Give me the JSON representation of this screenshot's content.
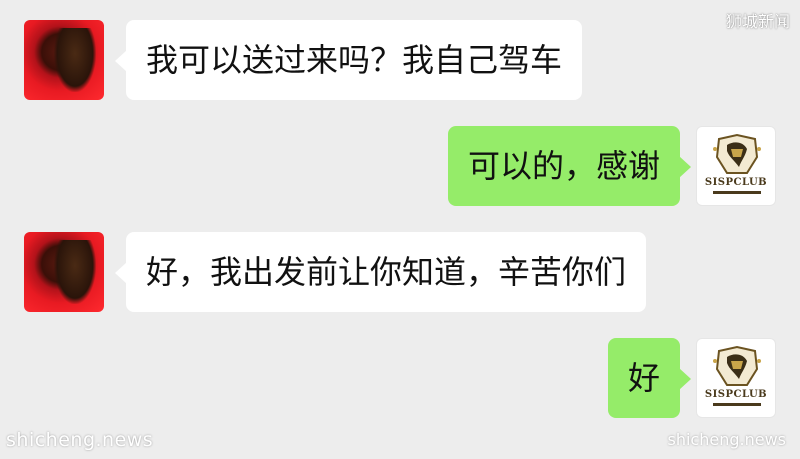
{
  "watermarks": {
    "top_right": "狮城新闻",
    "bottom_left": "shicheng.news",
    "bottom_right": "shicheng.news"
  },
  "contacts": {
    "left": {
      "avatar_icon": "red-photo-avatar-icon"
    },
    "right": {
      "avatar_icon": "sispclub-logo-icon",
      "logo_text": "SISPCLUB"
    }
  },
  "messages": [
    {
      "side": "left",
      "text": "我可以送过来吗？我自己驾车"
    },
    {
      "side": "right",
      "text": "可以的，感谢"
    },
    {
      "side": "left",
      "text": "好，我出发前让你知道，辛苦你们"
    },
    {
      "side": "right",
      "text": "好"
    }
  ],
  "colors": {
    "background": "#ededed",
    "incoming_bubble": "#ffffff",
    "outgoing_bubble": "#95ec69"
  }
}
